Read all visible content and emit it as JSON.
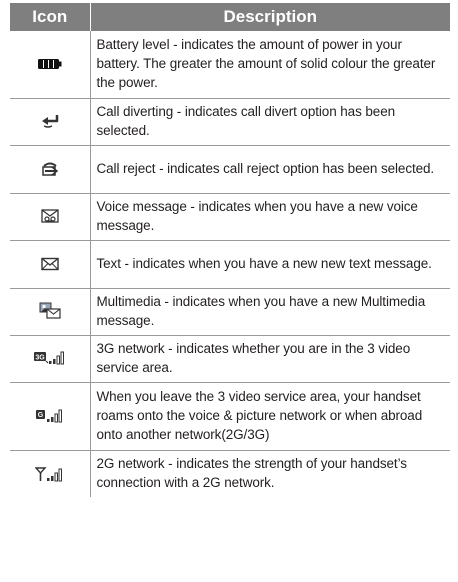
{
  "table": {
    "headers": {
      "icon": "Icon",
      "description": "Description"
    },
    "rows": [
      {
        "icon": "battery-level-icon",
        "description": "Battery level - indicates the amount of power in your battery. The greater the amount of solid colour the greater the power."
      },
      {
        "icon": "call-divert-icon",
        "description": "Call diverting - indicates call divert option has been selected."
      },
      {
        "icon": "call-reject-icon",
        "description": "Call reject - indicates call reject option has been selected."
      },
      {
        "icon": "voice-message-icon",
        "description": "Voice message - indicates when you have a new voice message."
      },
      {
        "icon": "text-message-icon",
        "description": "Text - indicates when you have a new new text message."
      },
      {
        "icon": "multimedia-message-icon",
        "description": "Multimedia - indicates when you have a new Multimedia message."
      },
      {
        "icon": "3g-network-icon",
        "description": "3G network - indicates whether you are in the 3 video service area."
      },
      {
        "icon": "roaming-network-icon",
        "description": "When you leave the 3 video service area, your handset roams onto the voice & picture network or when abroad onto another network(2G/3G)"
      },
      {
        "icon": "2g-network-icon",
        "description": "2G network - indicates the strength of your handset’s connection with a 2G network."
      }
    ]
  }
}
